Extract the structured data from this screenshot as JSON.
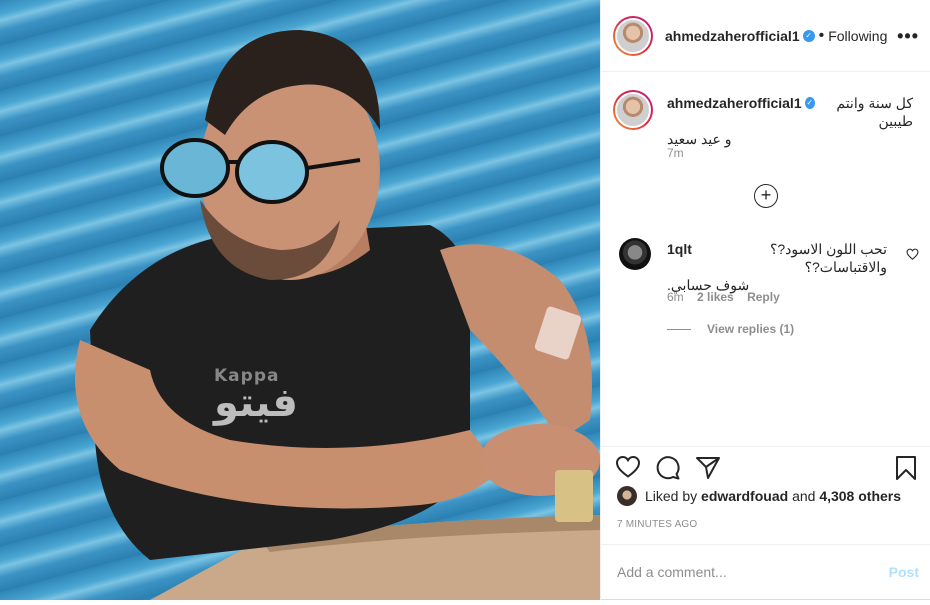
{
  "post": {
    "username": "ahmedzaherofficial1",
    "verified_glyph": "✓",
    "separator": "•",
    "follow_status": "Following",
    "more_glyph": "•••",
    "caption_line1": "كل سنة وانتم طيبين",
    "caption_line2": "و عيد سعيد",
    "caption_time": "7m",
    "load_more_glyph": "+",
    "photo_watermark_brand": "Kappa",
    "photo_watermark_text": "فيتو"
  },
  "comment": {
    "username": "1qlt",
    "text_line1": "تحب اللون الاسود?؟ والاقتباسات?؟",
    "text_line2": "شوف حسابي.",
    "time": "6m",
    "likes": "2 likes",
    "reply": "Reply",
    "view_replies": "View replies (1)"
  },
  "actions": {
    "icons": [
      "heart-icon",
      "comment-icon",
      "share-icon",
      "bookmark-icon"
    ]
  },
  "likes": {
    "prefix": "Liked by",
    "user": "edwardfouad",
    "and": "and",
    "others": "4,308 others"
  },
  "timestamp": "7 MINUTES AGO",
  "add_comment": {
    "placeholder": "Add a comment...",
    "post_label": "Post"
  },
  "colors": {
    "text": "#262626",
    "secondary": "#8e8e8e",
    "verified": "#3897f0",
    "post_disabled": "#b2dffc"
  }
}
